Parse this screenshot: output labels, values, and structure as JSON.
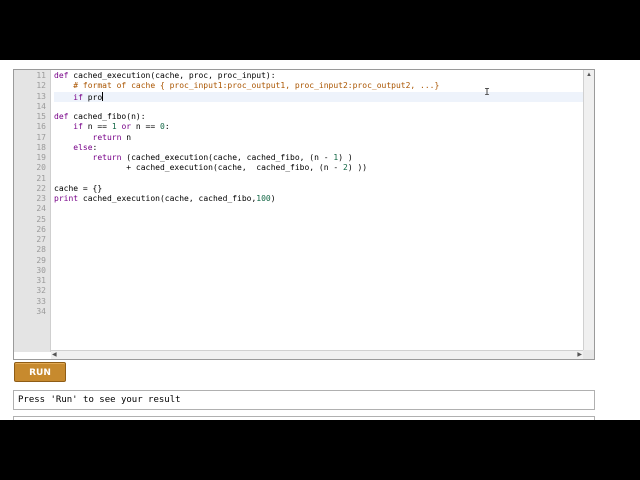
{
  "editor": {
    "line_numbers": [
      "11",
      "12",
      "13",
      "14",
      "15",
      "16",
      "17",
      "18",
      "19",
      "20",
      "21",
      "22",
      "23",
      "24",
      "25",
      "26",
      "27",
      "28",
      "29",
      "30",
      "31",
      "32",
      "33",
      "34"
    ],
    "lines": [
      [
        {
          "t": "def ",
          "c": "kw"
        },
        {
          "t": "cached_execution(cache, proc, proc_input):",
          "c": ""
        }
      ],
      [
        {
          "t": "    ",
          "c": ""
        },
        {
          "t": "# format of cache { proc_input1:proc_output1, proc_input2:proc_output2, ...}",
          "c": "cmt"
        }
      ],
      [
        {
          "t": "    ",
          "c": ""
        },
        {
          "t": "if ",
          "c": "kw"
        },
        {
          "t": "pro",
          "c": ""
        }
      ],
      [],
      [
        {
          "t": "def ",
          "c": "kw"
        },
        {
          "t": "cached_fibo(n):",
          "c": ""
        }
      ],
      [
        {
          "t": "    ",
          "c": ""
        },
        {
          "t": "if ",
          "c": "kw"
        },
        {
          "t": "n == ",
          "c": ""
        },
        {
          "t": "1 ",
          "c": "num"
        },
        {
          "t": "or ",
          "c": "kw"
        },
        {
          "t": "n == ",
          "c": ""
        },
        {
          "t": "0",
          "c": "num"
        },
        {
          "t": ":",
          "c": ""
        }
      ],
      [
        {
          "t": "        ",
          "c": ""
        },
        {
          "t": "return ",
          "c": "kw"
        },
        {
          "t": "n",
          "c": ""
        }
      ],
      [
        {
          "t": "    ",
          "c": ""
        },
        {
          "t": "else",
          "c": "kw"
        },
        {
          "t": ":",
          "c": ""
        }
      ],
      [
        {
          "t": "        ",
          "c": ""
        },
        {
          "t": "return ",
          "c": "kw"
        },
        {
          "t": "(cached_execution(cache, cached_fibo, (n - ",
          "c": ""
        },
        {
          "t": "1",
          "c": "num"
        },
        {
          "t": ") )",
          "c": ""
        }
      ],
      [
        {
          "t": "               + cached_execution(cache,  cached_fibo, (n - ",
          "c": ""
        },
        {
          "t": "2",
          "c": "num"
        },
        {
          "t": ") ))",
          "c": ""
        }
      ],
      [],
      [
        {
          "t": "cache = {}",
          "c": ""
        }
      ],
      [
        {
          "t": "print ",
          "c": "kw"
        },
        {
          "t": "cached_execution(cache, cached_fibo,",
          "c": ""
        },
        {
          "t": "100",
          "c": "num"
        },
        {
          "t": ")",
          "c": ""
        }
      ],
      []
    ],
    "active_line": 2,
    "gutter_marks": {
      "12": "1",
      "13": "0",
      "20": "1",
      "22": "1"
    }
  },
  "run_button": {
    "label": "RUN"
  },
  "result": {
    "text": "Press 'Run' to see your result"
  },
  "colors": {
    "run_bg": "#c78a2e",
    "keyword": "#770088",
    "number": "#116644",
    "comment": "#aa5500"
  }
}
